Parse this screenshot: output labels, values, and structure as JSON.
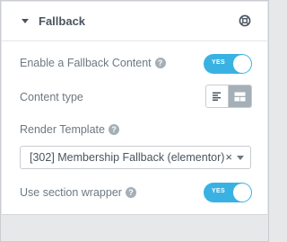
{
  "section": {
    "title": "Fallback",
    "help_icon": "help-circle-icon"
  },
  "controls": {
    "fallback": {
      "label": "Enable a Fallback Content",
      "help": "?",
      "toggle_text": "YES",
      "on": true
    },
    "content_type": {
      "label": "Content type",
      "options": [
        "text-icon",
        "template-icon"
      ],
      "selected": "template-icon"
    },
    "render_template": {
      "label": "Render Template",
      "help": "?",
      "value": "[302] Membership Fallback (elementor)",
      "clear": "×"
    },
    "section_wrapper": {
      "label": "Use section wrapper",
      "help": "?",
      "toggle_text": "YES",
      "on": true
    }
  },
  "colors": {
    "accent": "#39b2e3",
    "text": "#6d7882",
    "title": "#4a545e",
    "selected_option": "#a4afb7"
  }
}
